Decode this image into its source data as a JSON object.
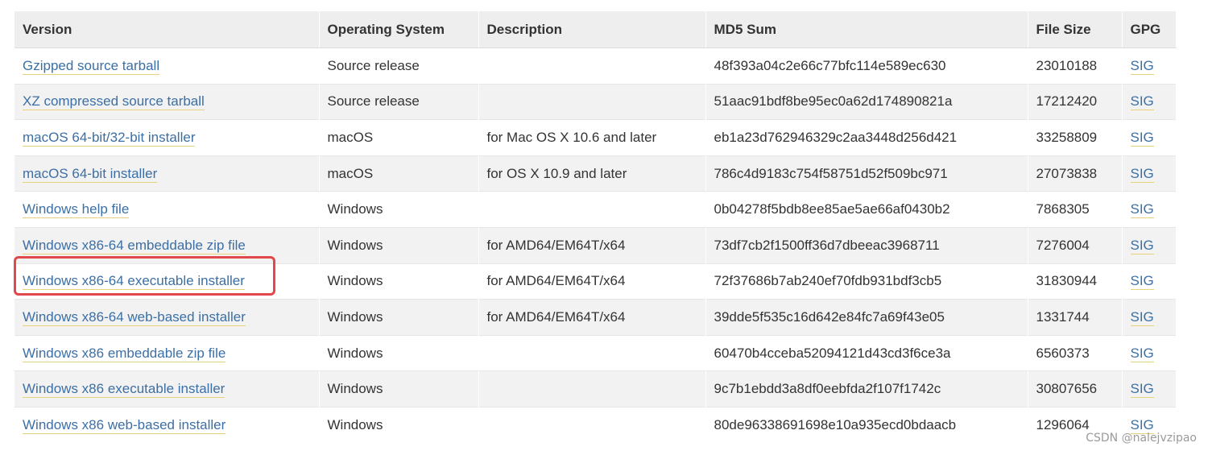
{
  "table": {
    "headers": {
      "version": "Version",
      "os": "Operating System",
      "description": "Description",
      "md5": "MD5 Sum",
      "size": "File Size",
      "gpg": "GPG"
    },
    "rows": [
      {
        "version": "Gzipped source tarball",
        "os": "Source release",
        "description": "",
        "md5": "48f393a04c2e66c77bfc114e589ec630",
        "size": "23010188",
        "gpg": "SIG"
      },
      {
        "version": "XZ compressed source tarball",
        "os": "Source release",
        "description": "",
        "md5": "51aac91bdf8be95ec0a62d174890821a",
        "size": "17212420",
        "gpg": "SIG"
      },
      {
        "version": "macOS 64-bit/32-bit installer",
        "os": "macOS",
        "description": "for Mac OS X 10.6 and later",
        "md5": "eb1a23d762946329c2aa3448d256d421",
        "size": "33258809",
        "gpg": "SIG"
      },
      {
        "version": "macOS 64-bit installer",
        "os": "macOS",
        "description": "for OS X 10.9 and later",
        "md5": "786c4d9183c754f58751d52f509bc971",
        "size": "27073838",
        "gpg": "SIG"
      },
      {
        "version": "Windows help file",
        "os": "Windows",
        "description": "",
        "md5": "0b04278f5bdb8ee85ae5ae66af0430b2",
        "size": "7868305",
        "gpg": "SIG"
      },
      {
        "version": "Windows x86-64 embeddable zip file",
        "os": "Windows",
        "description": "for AMD64/EM64T/x64",
        "md5": "73df7cb2f1500ff36d7dbeeac3968711",
        "size": "7276004",
        "gpg": "SIG"
      },
      {
        "version": "Windows x86-64 executable installer",
        "os": "Windows",
        "description": "for AMD64/EM64T/x64",
        "md5": "72f37686b7ab240ef70fdb931bdf3cb5",
        "size": "31830944",
        "gpg": "SIG"
      },
      {
        "version": "Windows x86-64 web-based installer",
        "os": "Windows",
        "description": "for AMD64/EM64T/x64",
        "md5": "39dde5f535c16d642e84fc7a69f43e05",
        "size": "1331744",
        "gpg": "SIG"
      },
      {
        "version": "Windows x86 embeddable zip file",
        "os": "Windows",
        "description": "",
        "md5": "60470b4cceba52094121d43cd3f6ce3a",
        "size": "6560373",
        "gpg": "SIG"
      },
      {
        "version": "Windows x86 executable installer",
        "os": "Windows",
        "description": "",
        "md5": "9c7b1ebdd3a8df0eebfda2f107f1742c",
        "size": "30807656",
        "gpg": "SIG"
      },
      {
        "version": "Windows x86 web-based installer",
        "os": "Windows",
        "description": "",
        "md5": "80de96338691698e10a935ecd0bdaacb",
        "size": "1296064",
        "gpg": "SIG"
      }
    ]
  },
  "highlight": {
    "row": "Windows x86-64 executable installer",
    "color": "#e0484b"
  },
  "colors": {
    "link": "#3b6fa6",
    "header_bg": "#eeeeee",
    "stripe_bg": "#f2f2f2"
  },
  "watermark": "CSDN @nalejvzipao"
}
